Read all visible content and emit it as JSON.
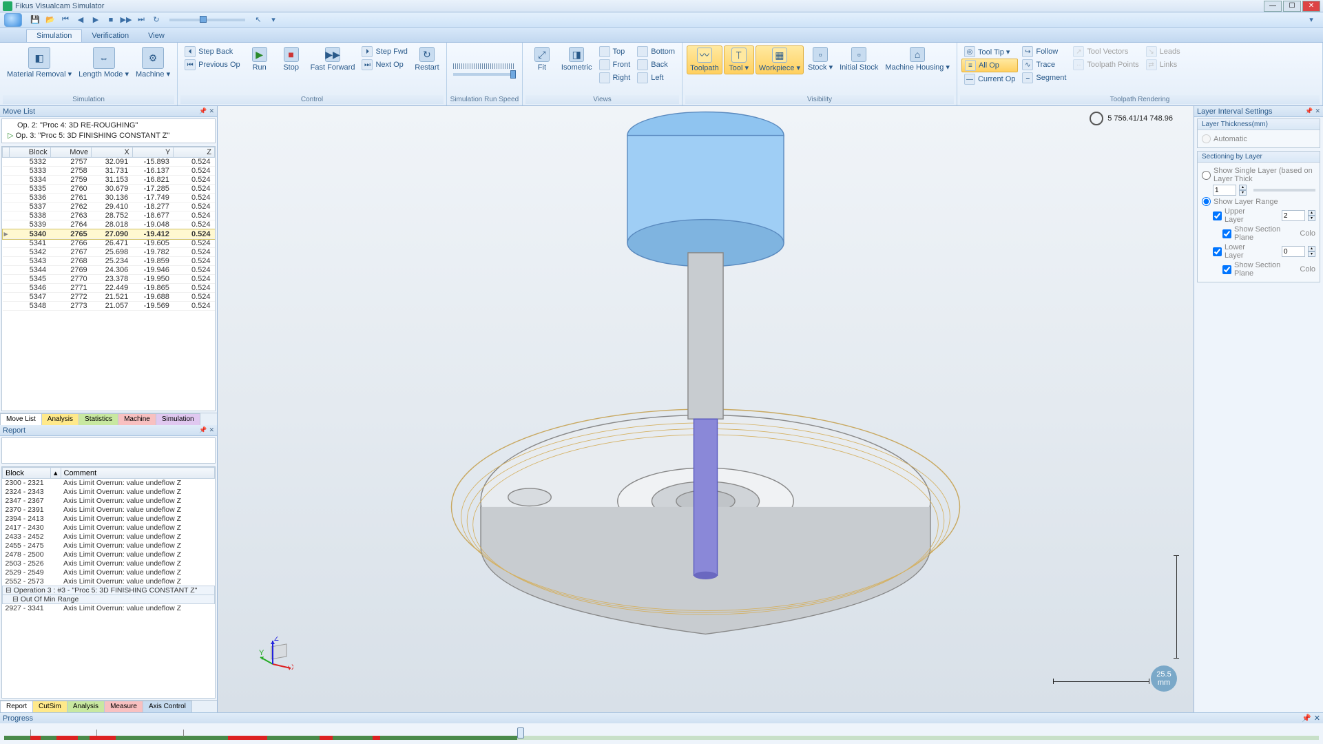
{
  "title": "Fikus Visualcam Simulator",
  "ribbon_tabs": {
    "simulation": "Simulation",
    "verification": "Verification",
    "view": "View"
  },
  "groups": {
    "simulation": {
      "material_removal": "Material\nRemoval ▾",
      "length_mode": "Length\nMode ▾",
      "machine": "Machine\n▾",
      "label": "Simulation"
    },
    "control": {
      "step_back": "Step Back",
      "previous_op": "Previous Op",
      "run": "Run",
      "stop": "Stop",
      "fast_forward": "Fast\nForward",
      "step_fwd": "Step Fwd",
      "next_op": "Next Op",
      "restart": "Restart",
      "label": "Control"
    },
    "speed": {
      "label": "Simulation Run Speed"
    },
    "views": {
      "fit": "Fit",
      "isometric": "Isometric",
      "top": "Top",
      "bottom": "Bottom",
      "front": "Front",
      "back": "Back",
      "right": "Right",
      "left": "Left",
      "label": "Views"
    },
    "visibility": {
      "toolpath": "Toolpath",
      "tool": "Tool\n▾",
      "workpiece": "Workpiece\n▾",
      "stock": "Stock\n▾",
      "initial_stock": "Initial\nStock",
      "machine_housing": "Machine\nHousing ▾",
      "label": "Visibility"
    },
    "rendering": {
      "tool_tip": "Tool Tip ▾",
      "all_op": "All Op",
      "current_op": "Current Op",
      "follow": "Follow",
      "trace": "Trace",
      "segment": "Segment",
      "tool_vectors": "Tool Vectors",
      "toolpath_points": "Toolpath Points",
      "leads": "Leads",
      "links": "Links",
      "label": "Toolpath Rendering"
    }
  },
  "clockTime": "5 756.41/14 748.96",
  "scaleValue": "25.5",
  "scaleUnit": "mm",
  "move_list": {
    "title": "Move List",
    "ops": [
      "Op. 2: \"Proc 4: 3D RE-ROUGHING\"",
      "Op. 3: \"Proc 5: 3D FINISHING CONSTANT Z\""
    ],
    "cols": {
      "block": "Block",
      "move": "Move",
      "x": "X",
      "y": "Y",
      "z": "Z"
    },
    "rows": [
      {
        "b": "5332",
        "m": "2757",
        "x": "32.091",
        "y": "-15.893",
        "z": "0.524"
      },
      {
        "b": "5333",
        "m": "2758",
        "x": "31.731",
        "y": "-16.137",
        "z": "0.524"
      },
      {
        "b": "5334",
        "m": "2759",
        "x": "31.153",
        "y": "-16.821",
        "z": "0.524"
      },
      {
        "b": "5335",
        "m": "2760",
        "x": "30.679",
        "y": "-17.285",
        "z": "0.524"
      },
      {
        "b": "5336",
        "m": "2761",
        "x": "30.136",
        "y": "-17.749",
        "z": "0.524"
      },
      {
        "b": "5337",
        "m": "2762",
        "x": "29.410",
        "y": "-18.277",
        "z": "0.524"
      },
      {
        "b": "5338",
        "m": "2763",
        "x": "28.752",
        "y": "-18.677",
        "z": "0.524"
      },
      {
        "b": "5339",
        "m": "2764",
        "x": "28.018",
        "y": "-19.048",
        "z": "0.524"
      },
      {
        "b": "5340",
        "m": "2765",
        "x": "27.090",
        "y": "-19.412",
        "z": "0.524",
        "sel": true
      },
      {
        "b": "5341",
        "m": "2766",
        "x": "26.471",
        "y": "-19.605",
        "z": "0.524"
      },
      {
        "b": "5342",
        "m": "2767",
        "x": "25.698",
        "y": "-19.782",
        "z": "0.524"
      },
      {
        "b": "5343",
        "m": "2768",
        "x": "25.234",
        "y": "-19.859",
        "z": "0.524"
      },
      {
        "b": "5344",
        "m": "2769",
        "x": "24.306",
        "y": "-19.946",
        "z": "0.524"
      },
      {
        "b": "5345",
        "m": "2770",
        "x": "23.378",
        "y": "-19.950",
        "z": "0.524"
      },
      {
        "b": "5346",
        "m": "2771",
        "x": "22.449",
        "y": "-19.865",
        "z": "0.524"
      },
      {
        "b": "5347",
        "m": "2772",
        "x": "21.521",
        "y": "-19.688",
        "z": "0.524"
      },
      {
        "b": "5348",
        "m": "2773",
        "x": "21.057",
        "y": "-19.569",
        "z": "0.524"
      }
    ],
    "tabs": [
      "Move List",
      "Analysis",
      "Statistics",
      "Machine",
      "Simulation"
    ]
  },
  "report": {
    "title": "Report",
    "cols": {
      "block": "Block",
      "comment": "Comment"
    },
    "rows": [
      {
        "b": "2300 - 2321",
        "c": "Axis Limit Overrun:   value undeflow Z"
      },
      {
        "b": "2324 - 2343",
        "c": "Axis Limit Overrun:   value undeflow Z"
      },
      {
        "b": "2347 - 2367",
        "c": "Axis Limit Overrun:   value undeflow Z"
      },
      {
        "b": "2370 - 2391",
        "c": "Axis Limit Overrun:   value undeflow Z"
      },
      {
        "b": "2394 - 2413",
        "c": "Axis Limit Overrun:   value undeflow Z"
      },
      {
        "b": "2417 - 2430",
        "c": "Axis Limit Overrun:   value undeflow Z"
      },
      {
        "b": "2433 - 2452",
        "c": "Axis Limit Overrun:   value undeflow Z"
      },
      {
        "b": "2455 - 2475",
        "c": "Axis Limit Overrun:   value undeflow Z"
      },
      {
        "b": "2478 - 2500",
        "c": "Axis Limit Overrun:   value undeflow Z"
      },
      {
        "b": "2503 - 2526",
        "c": "Axis Limit Overrun:   value undeflow Z"
      },
      {
        "b": "2529 - 2549",
        "c": "Axis Limit Overrun:   value undeflow Z"
      },
      {
        "b": "2552 - 2573",
        "c": "Axis Limit Overrun:   value undeflow Z"
      }
    ],
    "opRow": "Operation 3 : #3 - \"Proc 5: 3D FINISHING CONSTANT Z\"",
    "rangeRow": "Out Of Min Range",
    "lastRow": {
      "b": "2927 - 3341",
      "c": "Axis Limit Overrun:   value undeflow Z"
    },
    "tabs": [
      "Report",
      "CutSim",
      "Analysis",
      "Measure",
      "Axis Control"
    ]
  },
  "layer": {
    "title": "Layer Interval Settings",
    "thickness_hdr": "Layer Thickness(mm)",
    "automatic": "Automatic",
    "sectioning_hdr": "Sectioning by Layer",
    "show_single": "Show Single Layer (based on Layer Thick",
    "single_val": "1",
    "show_range": "Show Layer Range",
    "upper": "Upper Layer",
    "upper_val": "2",
    "show_section1": "Show Section Plane",
    "colo1": "Colo",
    "lower": "Lower Layer",
    "lower_val": "0",
    "show_section2": "Show Section Plane",
    "colo2": "Colo"
  },
  "progress": {
    "title": "Progress"
  },
  "axis_labels": {
    "x": "X",
    "y": "Y",
    "z": "Z"
  }
}
